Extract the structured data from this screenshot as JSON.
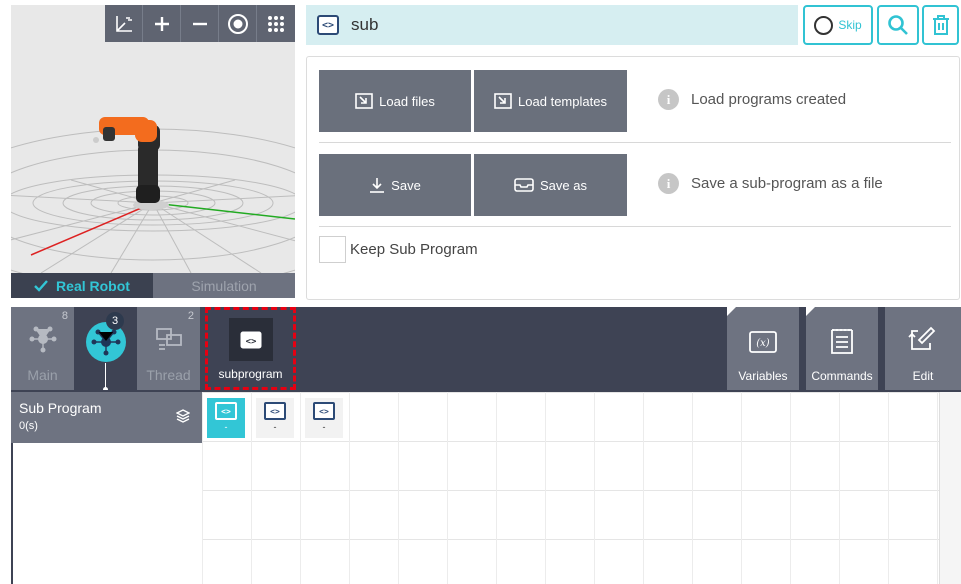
{
  "viewport": {
    "toolbar": [
      {
        "name": "axes-view-icon"
      },
      {
        "name": "zoom-in-icon"
      },
      {
        "name": "zoom-out-icon"
      },
      {
        "name": "eye-icon"
      },
      {
        "name": "grid-menu-icon"
      }
    ],
    "tabs": {
      "real_robot": "Real Robot",
      "simulation": "Simulation"
    }
  },
  "header": {
    "title": "sub",
    "skip_label": "Skip"
  },
  "panel": {
    "load_files": "Load files",
    "load_templates": "Load templates",
    "load_info": "Load programs created",
    "save": "Save",
    "save_as": "Save as",
    "save_info": "Save a sub-program as a file",
    "keep_label": "Keep Sub Program",
    "keep_checked": false
  },
  "modes": [
    {
      "label": "Main",
      "count": "8"
    },
    {
      "label": "",
      "count": "3"
    },
    {
      "label": "Thread",
      "count": "2"
    }
  ],
  "subprogram_tile": {
    "label": "subprogram"
  },
  "right_buttons": {
    "variables": "Variables",
    "commands": "Commands",
    "edit": "Edit"
  },
  "sub_program": {
    "title": "Sub Program",
    "time": "0(s)"
  },
  "timeline_cells": [
    {
      "caption": "-"
    },
    {
      "caption": "-"
    },
    {
      "caption": "-"
    }
  ],
  "colors": {
    "accent": "#32c6d6",
    "dark": "#3e4354",
    "button": "#6a707c",
    "highlight_border": "#e60012"
  }
}
